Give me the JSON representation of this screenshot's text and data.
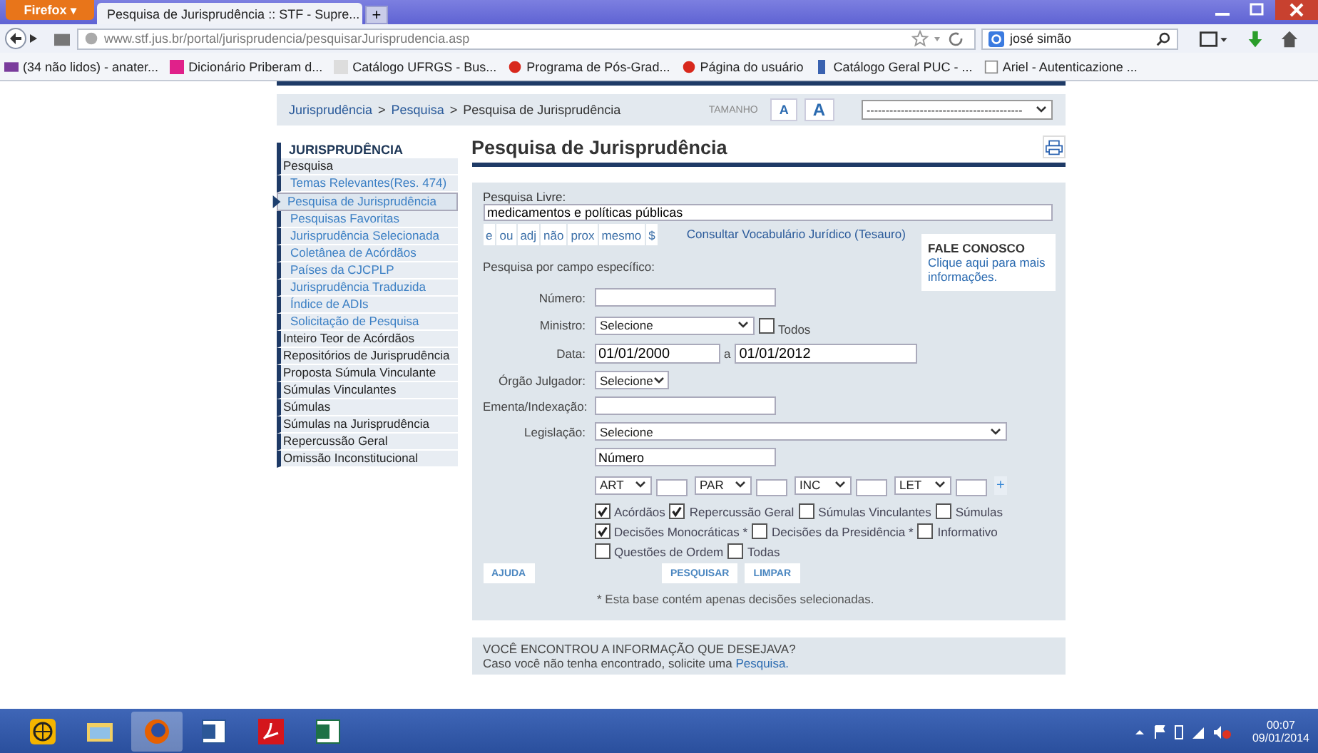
{
  "browser": {
    "menu_button": "Firefox",
    "menu_caret": "▾",
    "tab_title": "Pesquisa de Jurisprudência :: STF - Supre...",
    "new_tab": "+",
    "url": "www.stf.jus.br/portal/jurisprudencia/pesquisarJurisprudencia.asp",
    "search_value": "josé simão",
    "bookmarks": [
      {
        "label": "(34 não lidos) - anater..."
      },
      {
        "label": "Dicionário Priberam d..."
      },
      {
        "label": "Catálogo UFRGS - Bus..."
      },
      {
        "label": "Programa de Pós-Grad..."
      },
      {
        "label": "Página do usuário"
      },
      {
        "label": "Catálogo Geral PUC - ..."
      },
      {
        "label": "Ariel - Autenticazione ..."
      }
    ]
  },
  "breadcrumb": {
    "separator": ">",
    "items": [
      {
        "label": "Jurisprudência",
        "link": true
      },
      {
        "label": "Pesquisa",
        "link": true
      },
      {
        "label": "Pesquisa de Jurisprudência",
        "link": false
      }
    ]
  },
  "font_size": {
    "label": "TAMANHO",
    "buttons": [
      "A",
      "A"
    ]
  },
  "site_select": {
    "value": "-----------------------------------------"
  },
  "sidebar": {
    "heading": "JURISPRUDÊNCIA",
    "items": [
      {
        "label": "Pesquisa",
        "selected": false,
        "children": [
          {
            "label": "Temas Relevantes(Res. 474)",
            "selected": false
          },
          {
            "label": "Pesquisa de Jurisprudência",
            "selected": true
          },
          {
            "label": "Pesquisas Favoritas",
            "selected": false
          },
          {
            "label": "Jurisprudência Selecionada",
            "selected": false
          },
          {
            "label": "Coletânea de Acórdãos",
            "selected": false
          },
          {
            "label": "Países da CJCPLP",
            "selected": false
          },
          {
            "label": "Jurisprudência Traduzida",
            "selected": false
          },
          {
            "label": "Índice de ADIs",
            "selected": false
          },
          {
            "label": "Solicitação de Pesquisa",
            "selected": false
          }
        ]
      },
      {
        "label": "Inteiro Teor de Acórdãos",
        "selected": false
      },
      {
        "label": "Repositórios de Jurisprudência",
        "selected": false
      },
      {
        "label": "Proposta Súmula Vinculante",
        "selected": false
      },
      {
        "label": "Súmulas Vinculantes",
        "selected": false
      },
      {
        "label": "Súmulas",
        "selected": false
      },
      {
        "label": "Súmulas na Jurisprudência",
        "selected": false
      },
      {
        "label": "Repercussão Geral",
        "selected": false
      },
      {
        "label": "Omissão Inconstitucional",
        "selected": false
      }
    ]
  },
  "title": "Pesquisa de Jurisprudência",
  "form": {
    "free_search": {
      "label": "Pesquisa Livre:",
      "value": "medicamentos e políticas públicas"
    },
    "operators": [
      "e",
      "ou",
      "adj",
      "não",
      "prox",
      "mesmo",
      "$"
    ],
    "thesaurus_link": "Consultar Vocabulário Jurídico (Tesauro)",
    "contact": {
      "heading": "FALE CONOSCO",
      "link": "Clique aqui para mais informações."
    },
    "section_label": "Pesquisa por campo específico:",
    "fields": [
      {
        "kind": "text",
        "label": "Número:"
      },
      {
        "kind": "select",
        "label": "Ministro:",
        "value": "Selecione",
        "checkbox": {
          "label": "Todos",
          "checked": false
        }
      },
      {
        "kind": "range",
        "label": "Data:",
        "from": "01/01/2000",
        "separator": "a",
        "to": "01/01/2012"
      },
      {
        "kind": "small_select",
        "label": "Órgão Julgador:",
        "value": "Selecione"
      },
      {
        "kind": "text",
        "label": "Ementa/Indexação:"
      },
      {
        "kind": "wide_select",
        "label": "Legislação:",
        "value": "Selecione"
      }
    ],
    "legislation_number": {
      "value": "Número"
    },
    "legislation_parts": [
      {
        "value": "ART"
      },
      {
        "value": "PAR"
      },
      {
        "value": "INC"
      },
      {
        "value": "LET"
      }
    ],
    "add_button": "+",
    "collection_rows": [
      {
        "options": [
          {
            "label": "Acórdãos",
            "checked": true
          },
          {
            "label": "Repercussão Geral",
            "checked": true
          },
          {
            "label": "Súmulas Vinculantes",
            "checked": false
          },
          {
            "label": "Súmulas",
            "checked": false
          }
        ]
      },
      {
        "options": [
          {
            "label": "Decisões Monocráticas *",
            "checked": true
          },
          {
            "label": "Decisões da Presidência *",
            "checked": false
          },
          {
            "label": "Informativo",
            "checked": false
          }
        ]
      },
      {
        "options": [
          {
            "label": "Questões de Ordem",
            "checked": false
          },
          {
            "label": "Todas",
            "checked": false
          }
        ]
      }
    ],
    "help_button": "AJUDA",
    "search_button": "PESQUISAR",
    "clear_button": "LIMPAR",
    "note": "* Esta base contém apenas decisões selecionadas."
  },
  "footer": {
    "heading": "VOCÊ ENCONTROU A INFORMAÇÃO QUE DESEJAVA?",
    "text": "Caso você não tenha encontrado, solicite uma",
    "link": "Pesquisa."
  },
  "taskbar": {
    "apps": [
      {
        "selected": false
      },
      {
        "selected": false
      },
      {
        "selected": true
      },
      {
        "selected": false
      },
      {
        "selected": false
      },
      {
        "selected": false
      }
    ],
    "time": "00:07",
    "date": "09/01/2014"
  }
}
